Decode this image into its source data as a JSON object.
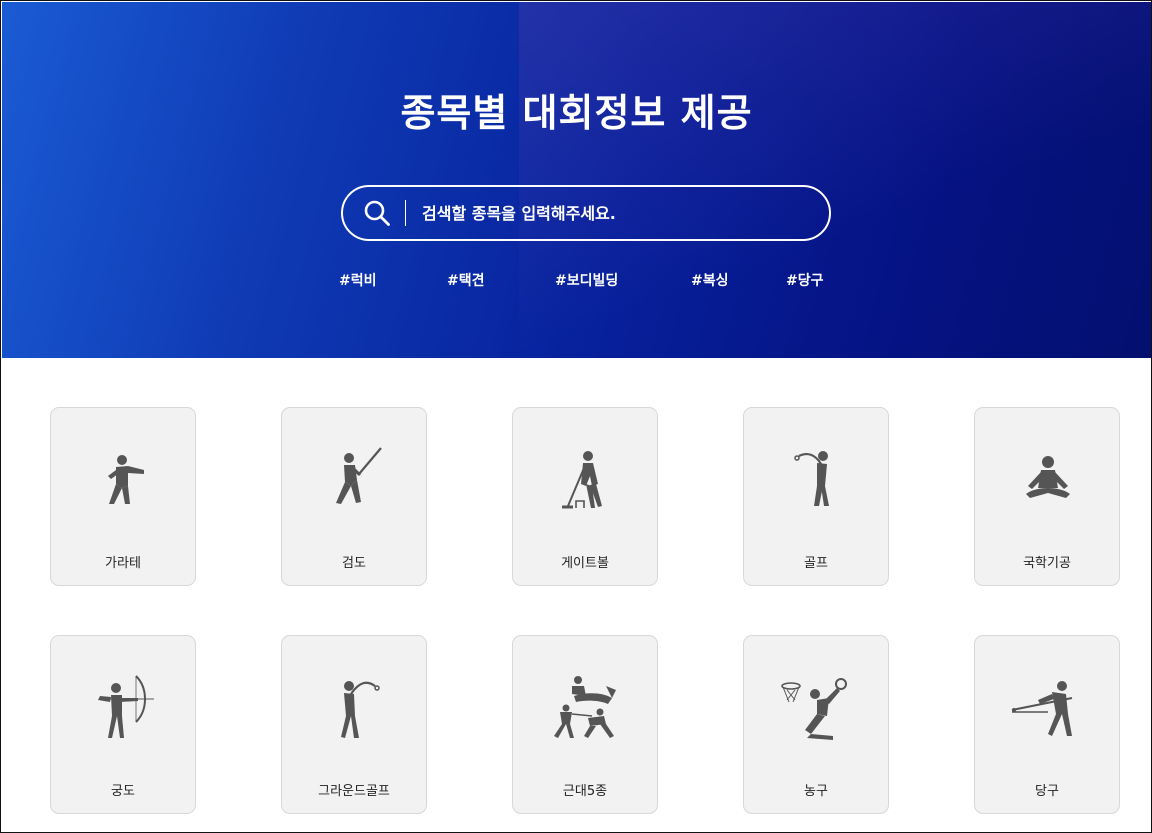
{
  "hero": {
    "title": "종목별 대회정보 제공",
    "search_placeholder": "검색할 종목을 입력해주세요.",
    "tags": [
      "#럭비",
      "#택견",
      "#보디빌딩",
      "#복싱",
      "#당구"
    ]
  },
  "sports": [
    {
      "label": "가라테",
      "icon": "karate-icon"
    },
    {
      "label": "검도",
      "icon": "kendo-icon"
    },
    {
      "label": "게이트볼",
      "icon": "gateball-icon"
    },
    {
      "label": "골프",
      "icon": "golf-icon"
    },
    {
      "label": "국학기공",
      "icon": "qigong-icon"
    },
    {
      "label": "궁도",
      "icon": "archery-icon"
    },
    {
      "label": "그라운드골프",
      "icon": "ground-golf-icon"
    },
    {
      "label": "근대5종",
      "icon": "modern-pentathlon-icon"
    },
    {
      "label": "농구",
      "icon": "basketball-icon"
    },
    {
      "label": "당구",
      "icon": "billiards-icon"
    }
  ],
  "colors": {
    "hero_start": "#1a5bd4",
    "hero_end": "#04106f",
    "card_bg": "#f2f2f2",
    "icon": "#555555"
  }
}
